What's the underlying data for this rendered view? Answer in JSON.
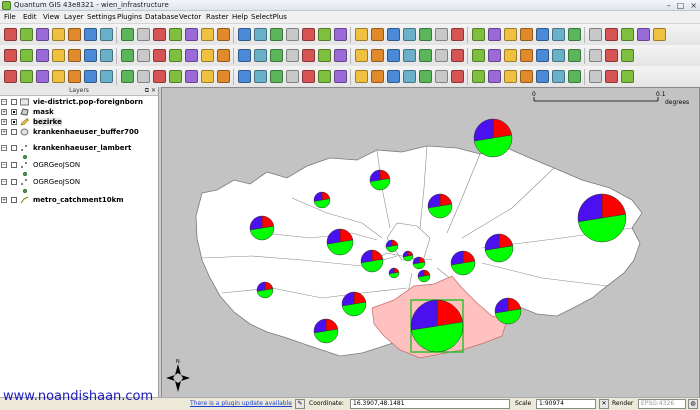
{
  "window": {
    "title": "Quantum GIS 43e8321 - wien_infrastructure",
    "minimize": "–",
    "maximize": "□",
    "close": "×"
  },
  "menu": [
    "File",
    "Edit",
    "View",
    "Layer",
    "Settings",
    "Plugins",
    "Database",
    "Vector",
    "Raster",
    "Help",
    "SelectPlus"
  ],
  "layers_panel": {
    "title": "Layers",
    "header_buttons": "⧉ ✕",
    "layers": [
      {
        "name": "vie-district.pop-foreignborn",
        "checked": false,
        "icon": "group-icon",
        "bold": true
      },
      {
        "name": "mask",
        "checked": true,
        "icon": "polygon-layer-icon",
        "bold": true
      },
      {
        "name": "bezirke",
        "checked": true,
        "icon": "edit-pencil-icon",
        "bold": true
      },
      {
        "name": "krankenhaeuser_buffer700",
        "checked": false,
        "icon": "polygon-layer-icon",
        "bold": true
      },
      {
        "name": "krankenhaeuser_lambert",
        "checked": false,
        "icon": "point-layer-icon",
        "bold": true
      },
      {
        "name": "OGRGeoJSON",
        "checked": false,
        "icon": "point-layer-icon",
        "bold": false
      },
      {
        "name": "OGRGeoJSON",
        "checked": false,
        "icon": "point-layer-icon",
        "bold": false
      },
      {
        "name": "metro_catchment10km",
        "checked": false,
        "icon": "line-layer-icon",
        "bold": true
      }
    ]
  },
  "map": {
    "scalebar": {
      "left_label": "0",
      "right_label": "0.1",
      "unit": "degrees"
    },
    "north_arrow": "N",
    "colors": {
      "background": "#c3c3c3",
      "district_fill": "#ffffff",
      "highlight": "#ffc0c0",
      "pie_blue": "#4a10f0",
      "pie_red": "#ff0000",
      "pie_green": "#00ff00",
      "selection": "#22c022"
    }
  },
  "statusbar": {
    "watermark": "www.noandishaan.com",
    "plugin_notice": "There is a plugin update available",
    "coordinate_label": "Coordinate:",
    "coordinate_value": "16.3907,48.1481",
    "scale_label": "Scale",
    "scale_value": "1:90974",
    "render_label": "Render",
    "crs": "EPSG:4326"
  }
}
